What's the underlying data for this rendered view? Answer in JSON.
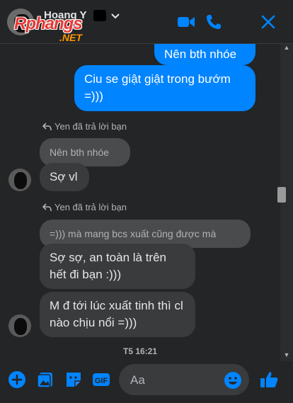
{
  "header": {
    "contact_name": "Hoang Y",
    "logo_main": "Rphangs",
    "logo_sub": ".NET"
  },
  "messages": [
    {
      "dir": "out",
      "text": "Nên bth nhóe"
    },
    {
      "dir": "out",
      "text": "Ciu se giật giật trong bướm =)))"
    },
    {
      "reply_meta": "Yen đã trả lời bạn",
      "quote": "Nên bth nhóe",
      "dir": "in",
      "text": "Sợ vl"
    },
    {
      "reply_meta": "Yen đã trả lời bạn",
      "quote": "=))) mà mang bcs xuất cũng được mà",
      "dir": "in",
      "text": "Sợ sợ, an toàn là trên hết đi bạn :)))"
    },
    {
      "dir": "in",
      "text": "M đ tới lúc xuất tinh thì cl nào chịu nổi =)))"
    }
  ],
  "timestamp": "T5 16:21",
  "composer": {
    "placeholder": "Aa"
  },
  "colors": {
    "accent": "#0084ff",
    "background": "#242526",
    "incoming": "#3a3b3c"
  },
  "icons": [
    "video-call-icon",
    "phone-icon",
    "close-icon",
    "plus-icon",
    "image-icon",
    "sticker-icon",
    "gif-icon",
    "emoji-icon",
    "like-icon"
  ]
}
